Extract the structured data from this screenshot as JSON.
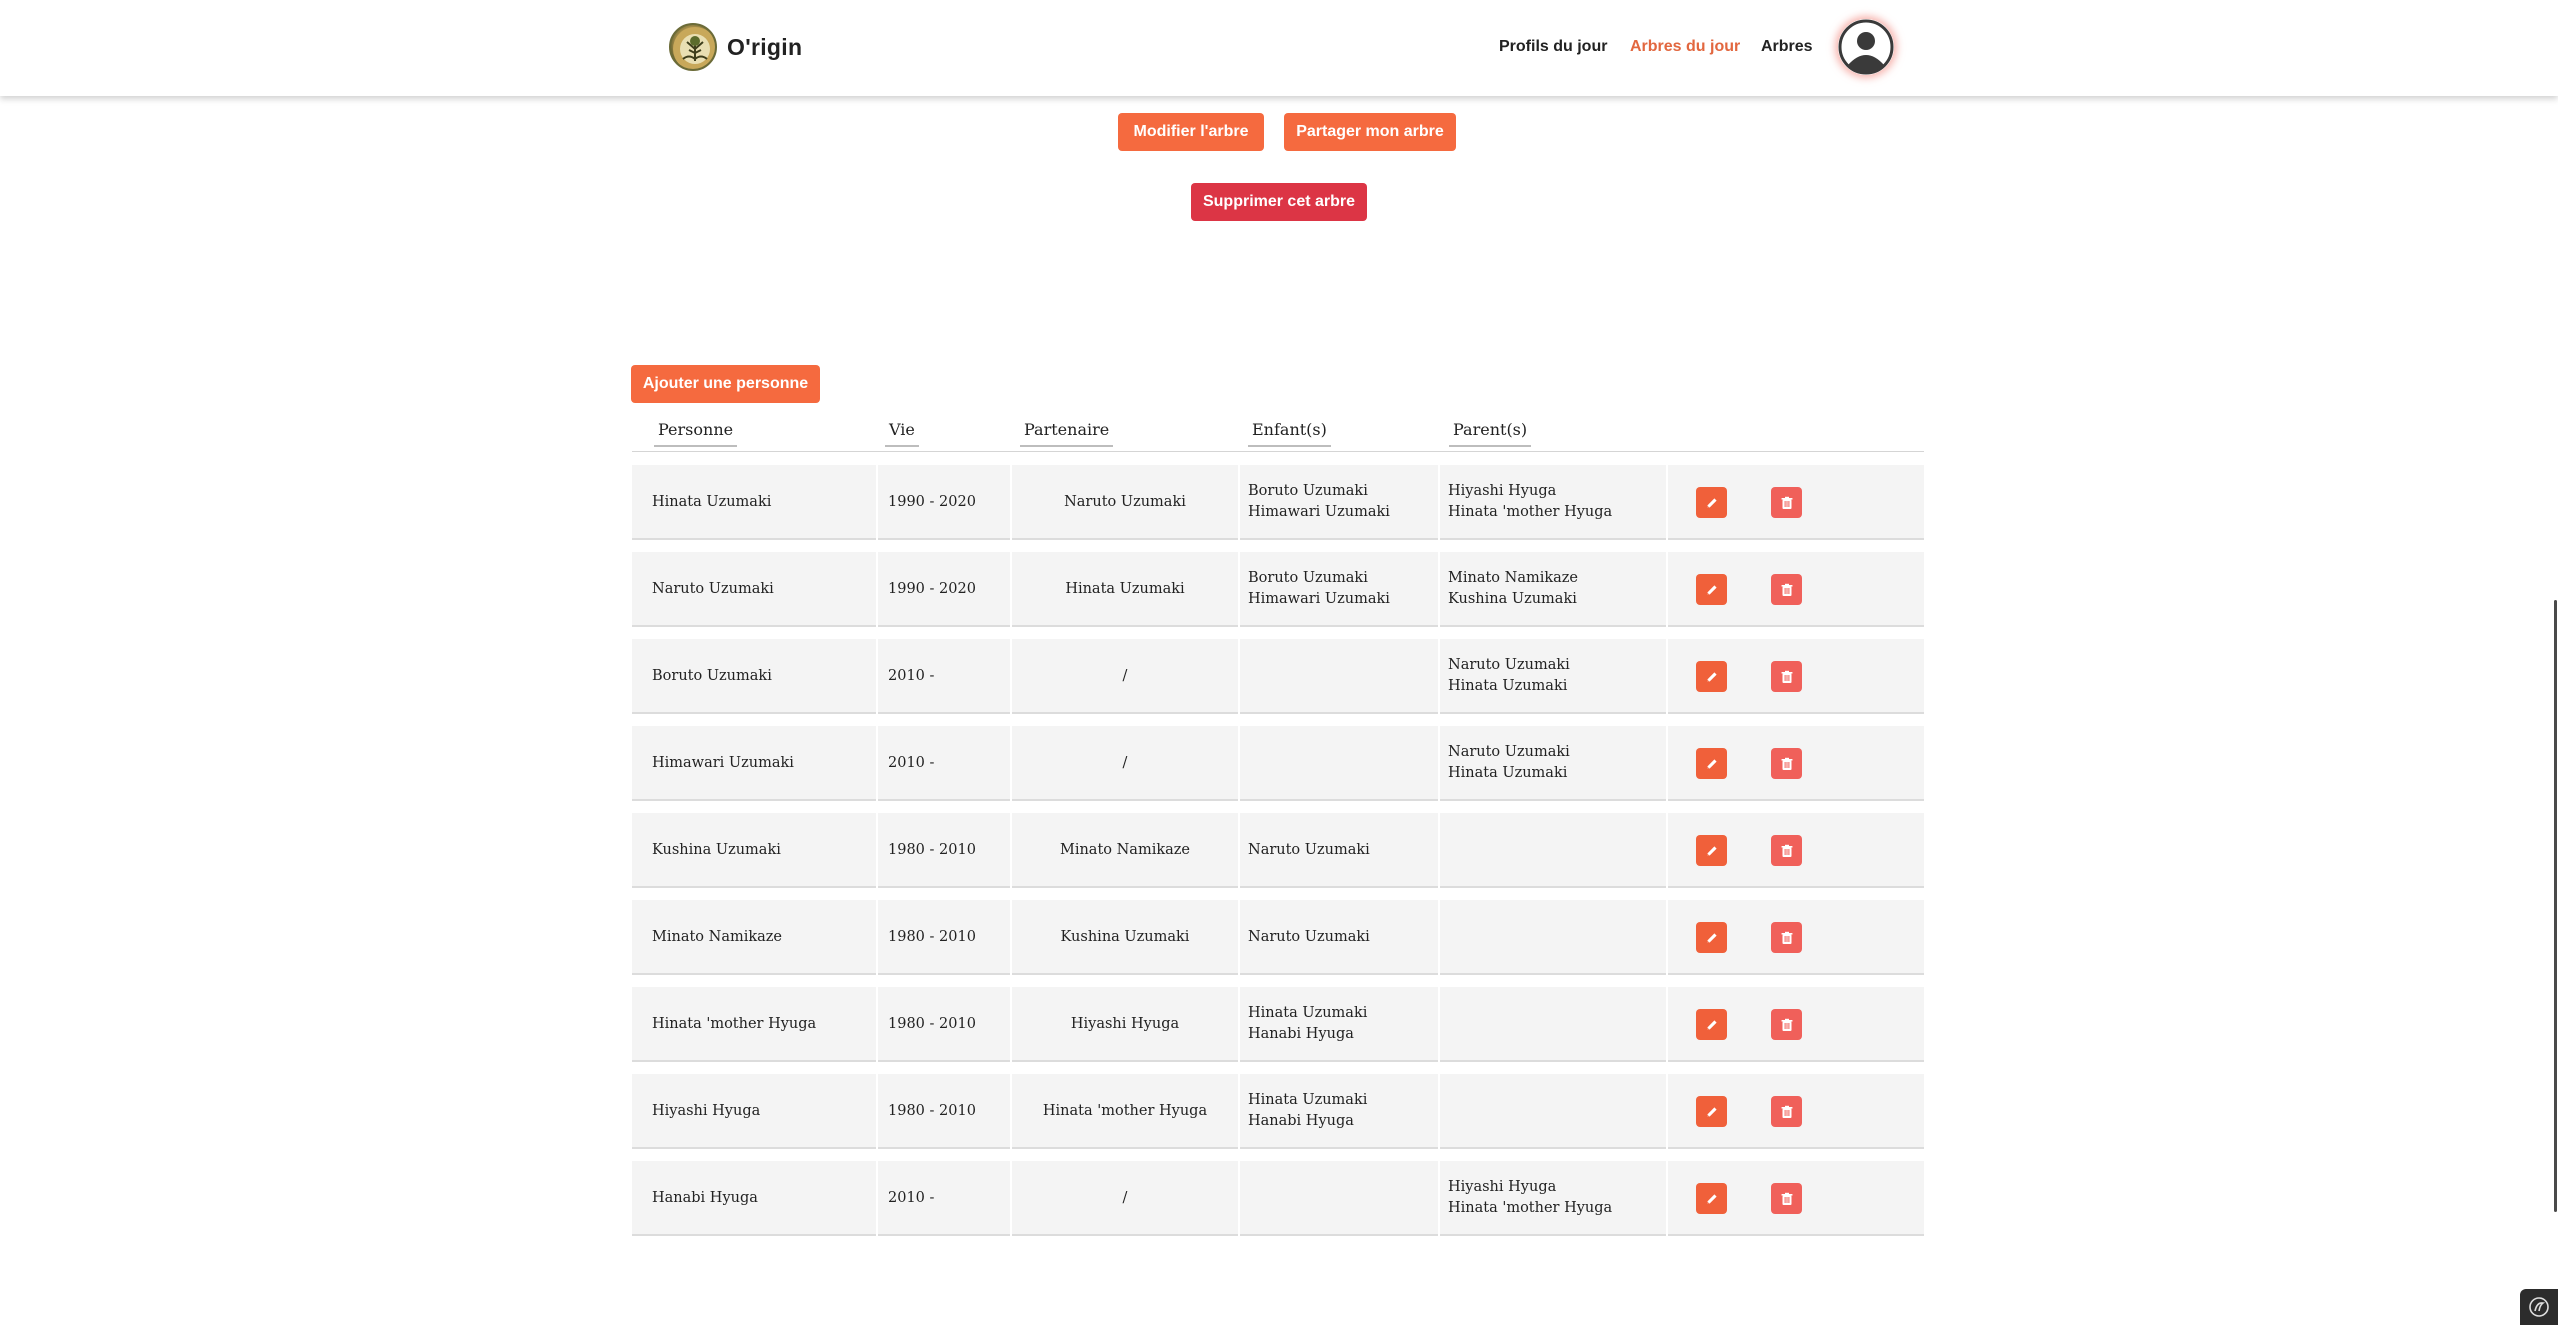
{
  "header": {
    "brand": "O'rigin",
    "nav": [
      {
        "label": "Profils du jour",
        "active": false
      },
      {
        "label": "Arbres du jour",
        "active": true
      },
      {
        "label": "Arbres",
        "active": false
      }
    ]
  },
  "actions": {
    "edit_tree": "Modifier l'arbre",
    "share_tree": "Partager mon arbre",
    "delete_tree": "Supprimer cet arbre",
    "add_person": "Ajouter une personne"
  },
  "table": {
    "headers": [
      "Personne",
      "Vie",
      "Partenaire",
      "Enfant(s)",
      "Parent(s)"
    ],
    "rows": [
      {
        "person": "Hinata Uzumaki",
        "life": "1990 - 2020",
        "partner": "Naruto Uzumaki",
        "children": [
          "Boruto Uzumaki",
          "Himawari Uzumaki"
        ],
        "parents": [
          "Hiyashi Hyuga",
          "Hinata 'mother Hyuga"
        ]
      },
      {
        "person": "Naruto Uzumaki",
        "life": "1990 - 2020",
        "partner": "Hinata Uzumaki",
        "children": [
          "Boruto Uzumaki",
          "Himawari Uzumaki"
        ],
        "parents": [
          "Minato Namikaze",
          "Kushina Uzumaki"
        ]
      },
      {
        "person": "Boruto Uzumaki",
        "life": "2010 -",
        "partner": "/",
        "children": [],
        "parents": [
          "Naruto Uzumaki",
          "Hinata Uzumaki"
        ]
      },
      {
        "person": "Himawari Uzumaki",
        "life": "2010 -",
        "partner": "/",
        "children": [],
        "parents": [
          "Naruto Uzumaki",
          "Hinata Uzumaki"
        ]
      },
      {
        "person": "Kushina Uzumaki",
        "life": "1980 - 2010",
        "partner": "Minato Namikaze",
        "children": [
          "Naruto Uzumaki"
        ],
        "parents": []
      },
      {
        "person": "Minato Namikaze",
        "life": "1980 - 2010",
        "partner": "Kushina Uzumaki",
        "children": [
          "Naruto Uzumaki"
        ],
        "parents": []
      },
      {
        "person": "Hinata 'mother Hyuga",
        "life": "1980 - 2010",
        "partner": "Hiyashi Hyuga",
        "children": [
          "Hinata Uzumaki",
          "Hanabi Hyuga"
        ],
        "parents": []
      },
      {
        "person": "Hiyashi Hyuga",
        "life": "1980 - 2010",
        "partner": "Hinata 'mother Hyuga",
        "children": [
          "Hinata Uzumaki",
          "Hanabi Hyuga"
        ],
        "parents": []
      },
      {
        "person": "Hanabi Hyuga",
        "life": "2010 -",
        "partner": "/",
        "children": [],
        "parents": [
          "Hiyashi Hyuga",
          "Hinata 'mother Hyuga"
        ]
      }
    ]
  },
  "icons": {
    "edit": "pencil-icon",
    "delete": "trash-icon",
    "profile": "user-avatar-icon",
    "logo": "tree-logo-icon"
  },
  "colors": {
    "accent": "#f56a3f",
    "danger": "#dc3545",
    "nav_active": "#e2673f"
  }
}
